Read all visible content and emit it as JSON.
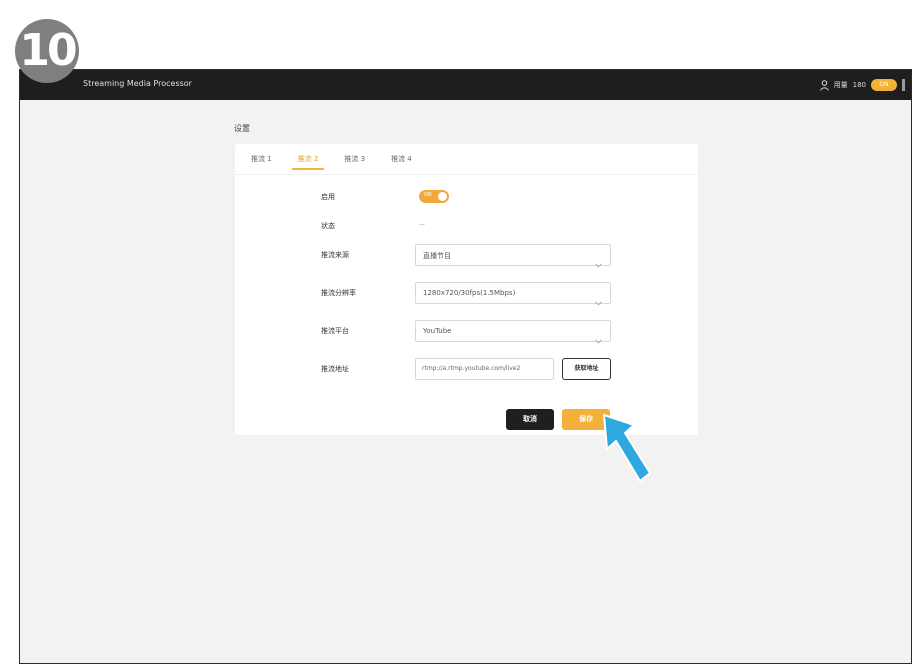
{
  "step_number": "10",
  "app": {
    "title": "Streaming Media Processor"
  },
  "topbar": {
    "user_label": "用量",
    "status_text": "180",
    "pill_label": "ON"
  },
  "page": {
    "title": "设置"
  },
  "tabs": [
    {
      "label": "推流 1"
    },
    {
      "label": "推流 2"
    },
    {
      "label": "推流 3"
    },
    {
      "label": "推流 4"
    }
  ],
  "form": {
    "enable_label": "启用",
    "toggle_text": "ON",
    "status_label": "状态",
    "status_value": "—",
    "source_label": "推流来源",
    "source_value": "直播节目",
    "resolution_label": "推流分辨率",
    "resolution_value": "1280x720/30fps(1.5Mbps)",
    "platform_label": "推流平台",
    "platform_value": "YouTube",
    "url_label": "推流地址",
    "url_value": "rtmp://a.rtmp.youtube.com/live2",
    "url_button": "获取地址",
    "cancel_button": "取消",
    "save_button": "保存"
  },
  "colors": {
    "accent": "#f3b13b",
    "arrow": "#2ea8de",
    "topbar": "#1e1e1e"
  }
}
